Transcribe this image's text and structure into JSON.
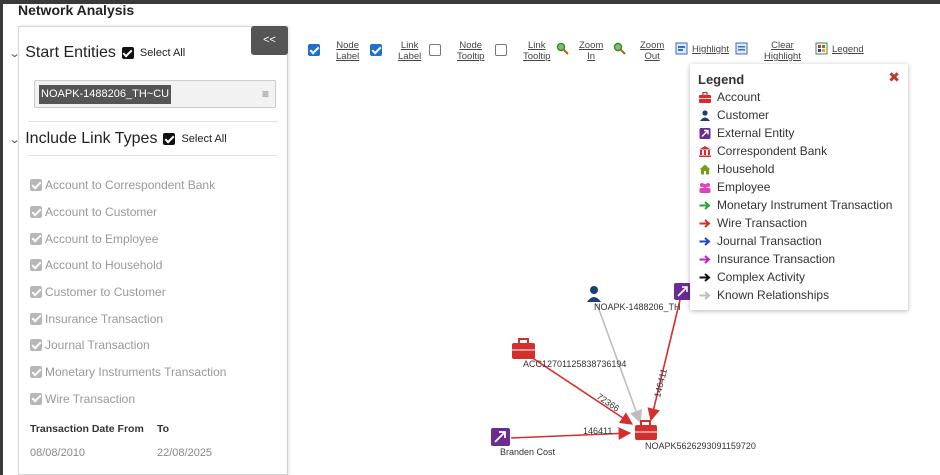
{
  "title": "Network Analysis",
  "collapse_label": "<<",
  "start_entities": {
    "heading": "Start Entities",
    "select_all": "Select All",
    "chip": "NOAPK-1488206_TH~CU"
  },
  "link_types": {
    "heading": "Include Link Types",
    "select_all": "Select All",
    "items": [
      "Account to Correspondent Bank",
      "Account to Customer",
      "Account to Employee",
      "Account to Household",
      "Customer to Customer",
      "Insurance Transaction",
      "Journal Transaction",
      "Monetary Instruments Transaction",
      "Wire Transaction"
    ]
  },
  "dates": {
    "from_label": "Transaction Date From",
    "to_label": "To",
    "from_value": "08/08/2010",
    "to_value": "22/08/2025"
  },
  "toolbar": {
    "node_label": [
      "Node",
      "Label"
    ],
    "link_label": [
      "Link",
      "Label"
    ],
    "node_tooltip": [
      "Node",
      "Tooltip"
    ],
    "link_tooltip": [
      "Link",
      "Tooltip"
    ],
    "zoom_in": [
      "Zoom",
      "In"
    ],
    "zoom_out": [
      "Zoom",
      "Out"
    ],
    "highlight": "Highlight",
    "clear_highlight": [
      "Clear",
      "Highlight"
    ],
    "legend": "Legend",
    "node_label_checked": true,
    "link_label_checked": true,
    "node_tooltip_checked": false,
    "link_tooltip_checked": false
  },
  "legend": {
    "title": "Legend",
    "items": [
      {
        "label": "Account",
        "icon": "briefcase-icon",
        "color": "#d32f2f"
      },
      {
        "label": "Customer",
        "icon": "person-icon",
        "color": "#1a3d7c"
      },
      {
        "label": "External Entity",
        "icon": "external-entity-icon",
        "color": "#6a2c91"
      },
      {
        "label": "Correspondent Bank",
        "icon": "bank-icon",
        "color": "#d32f2f"
      },
      {
        "label": "Household",
        "icon": "house-icon",
        "color": "#7a9a1a"
      },
      {
        "label": "Employee",
        "icon": "employee-icon",
        "color": "#e040c0"
      },
      {
        "label": "Monetary Instrument Transaction",
        "icon": "arrow-right-icon",
        "color": "#2e9e3e"
      },
      {
        "label": "Wire Transaction",
        "icon": "arrow-right-icon",
        "color": "#d32f2f"
      },
      {
        "label": "Journal Transaction",
        "icon": "arrow-right-icon",
        "color": "#2a44b8"
      },
      {
        "label": "Insurance Transaction",
        "icon": "arrow-right-icon",
        "color": "#c026c0"
      },
      {
        "label": "Complex Activity",
        "icon": "arrow-right-icon",
        "color": "#111111"
      },
      {
        "label": "Known Relationships",
        "icon": "arrow-right-icon",
        "color": "#bdbdbd"
      }
    ]
  },
  "graph": {
    "nodes": {
      "customer": "NOAPK-1488206_TH",
      "account": "ACC12701125838736194",
      "target": "NOAPK5626293091159720",
      "external": "Branden Cost"
    },
    "edge_labels": {
      "account_to_target": "72366",
      "external_to_target": "146411",
      "top_to_target": "146411"
    }
  }
}
